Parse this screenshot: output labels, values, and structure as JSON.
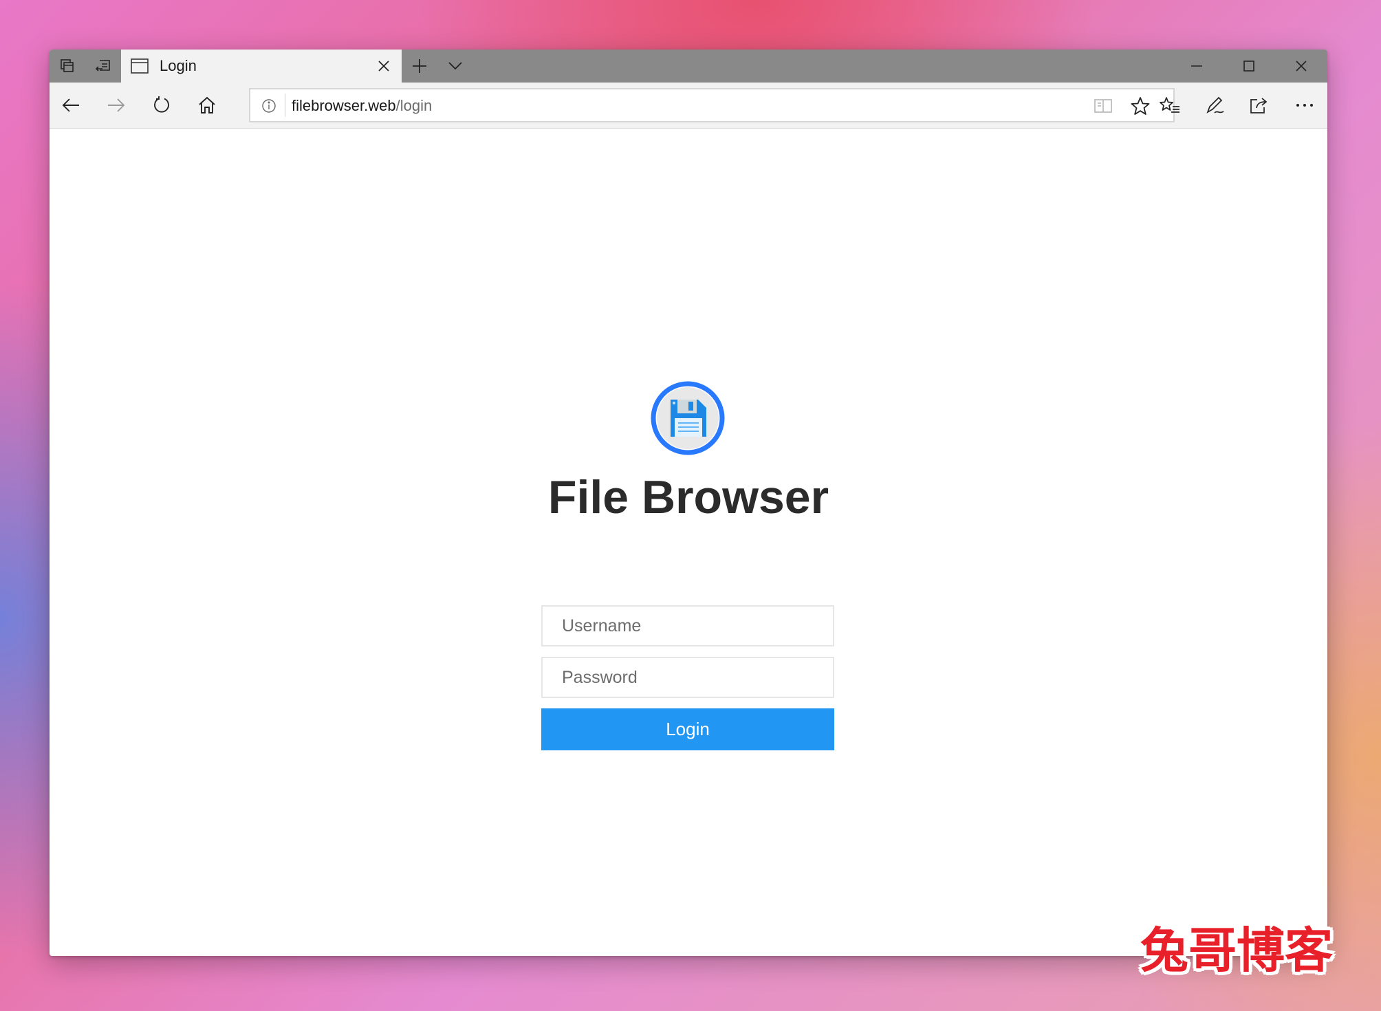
{
  "browser": {
    "tab": {
      "title": "Login",
      "favicon_icon": "window-icon",
      "close_icon": "close-icon"
    },
    "tabbar_icons": [
      "tabs-aside-icon",
      "restore-tabs-icon"
    ],
    "new_tab_icon": "plus-icon",
    "tab_list_icon": "chevron-down-icon",
    "window_controls": [
      "minimize-icon",
      "maximize-icon",
      "close-icon"
    ],
    "nav": {
      "back_icon": "back-arrow-icon",
      "forward_icon": "forward-arrow-icon",
      "refresh_icon": "refresh-icon",
      "home_icon": "home-icon"
    },
    "address": {
      "domain": "filebrowser.web",
      "path": "/login",
      "info_icon": "info-icon",
      "reading_view_icon": "book-icon",
      "favorite_icon": "star-icon"
    },
    "toolbar_icons": [
      "favorites-list-icon",
      "pen-icon",
      "share-icon",
      "more-icon"
    ]
  },
  "page": {
    "logo_icon": "floppy-disk-icon",
    "title": "File Browser",
    "username_placeholder": "Username",
    "password_placeholder": "Password",
    "login_label": "Login"
  },
  "watermark": "兔哥博客",
  "colors": {
    "accent": "#2196f3",
    "logo_ring": "#2979ff",
    "tabbar": "#898989",
    "navbar": "#f2f2f2",
    "watermark": "#e8202a"
  }
}
